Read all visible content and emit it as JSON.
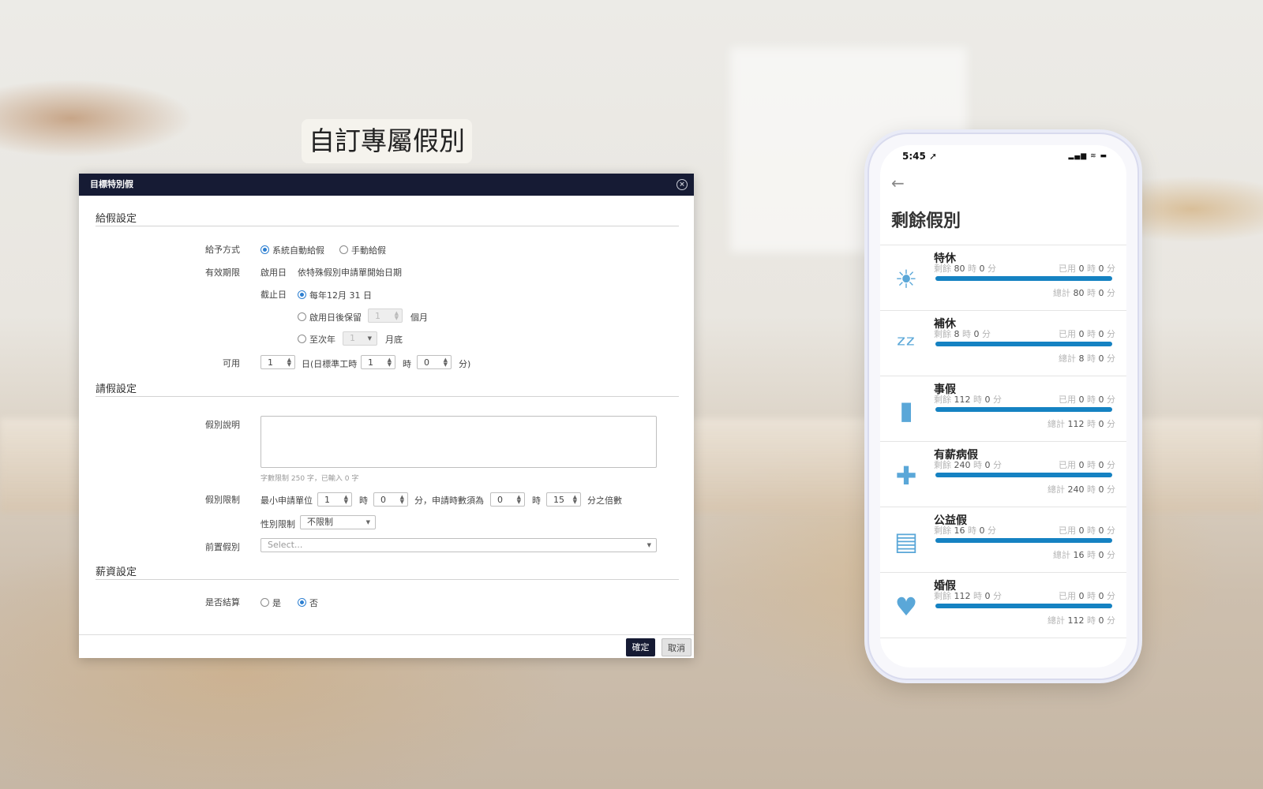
{
  "headline": "自訂專屬假別",
  "dialog": {
    "title": "目標特別假",
    "close_glyph": "×",
    "grant_section": {
      "title": "給假設定",
      "method_label": "給予方式",
      "method_auto": "系統自動給假",
      "method_manual": "手動給假",
      "validity_label": "有效期限",
      "start_label": "啟用日",
      "start_value": "依特殊假別申請單開始日期",
      "end_label": "截止日",
      "end_opt1": "每年12月 31 日",
      "end_opt2": "啟用日後保留",
      "end_opt2_value": "1",
      "end_opt2_unit": "個月",
      "end_opt3": "至次年",
      "end_opt3_value": "1",
      "end_opt3_unit": "月底",
      "available_label": "可用",
      "available_days": "1",
      "available_days_unit": "日(日標準工時",
      "available_hours": "1",
      "hours_unit": "時",
      "available_minutes": "0",
      "minutes_unit": "分)"
    },
    "apply_section": {
      "title": "請假設定",
      "desc_label": "假別說明",
      "desc_hint": "字數限制 250 字，已輸入 0 字",
      "limit_label": "假別限制",
      "min_unit_label": "最小申請單位",
      "min_hours": "1",
      "hours_unit": "時",
      "min_minutes": "0",
      "multiple_text": "分，申請時數須為",
      "mult_hours": "0",
      "mult_minutes": "15",
      "multiple_suffix": "分之倍數",
      "gender_label": "性別限制",
      "gender_value": "不限制",
      "prereq_label": "前置假別",
      "prereq_placeholder": "Select..."
    },
    "salary_section": {
      "title": "薪資設定",
      "settle_label": "是否結算",
      "yes": "是",
      "no": "否"
    },
    "ok_label": "確定",
    "cancel_label": "取消"
  },
  "phone": {
    "time": "5:45 ➚",
    "status_icons": "▂▄▆ ≋ ▬",
    "title": "剩餘假別",
    "remaining_key": "剩餘",
    "used_key": "已用",
    "total_key": "總計",
    "h": "時",
    "m": "分",
    "leaves": [
      {
        "name": "特休",
        "icon": "sun-hand-icon",
        "glyph": "☀",
        "rem_h": "80",
        "rem_m": "0",
        "used_h": "0",
        "used_m": "0",
        "tot_h": "80",
        "tot_m": "0",
        "progress": 1.0
      },
      {
        "name": "補休",
        "icon": "sleep-pillow-icon",
        "glyph": "ᶻᶻ",
        "rem_h": "8",
        "rem_m": "0",
        "used_h": "0",
        "used_m": "0",
        "tot_h": "8",
        "tot_m": "0",
        "progress": 1.0
      },
      {
        "name": "事假",
        "icon": "suitcase-icon",
        "glyph": "▮",
        "rem_h": "112",
        "rem_m": "0",
        "used_h": "0",
        "used_m": "0",
        "tot_h": "112",
        "tot_m": "0",
        "progress": 1.0
      },
      {
        "name": "有薪病假",
        "icon": "medical-kit-icon",
        "glyph": "✚",
        "rem_h": "240",
        "rem_m": "0",
        "used_h": "0",
        "used_m": "0",
        "tot_h": "240",
        "tot_m": "0",
        "progress": 1.0
      },
      {
        "name": "公益假",
        "icon": "calendar-document-icon",
        "glyph": "▤",
        "rem_h": "16",
        "rem_m": "0",
        "used_h": "0",
        "used_m": "0",
        "tot_h": "16",
        "tot_m": "0",
        "progress": 1.0
      },
      {
        "name": "婚假",
        "icon": "wedding-heart-icon",
        "glyph": "♥",
        "rem_h": "112",
        "rem_m": "0",
        "used_h": "0",
        "used_m": "0",
        "tot_h": "112",
        "tot_m": "0",
        "progress": 1.0
      }
    ]
  }
}
